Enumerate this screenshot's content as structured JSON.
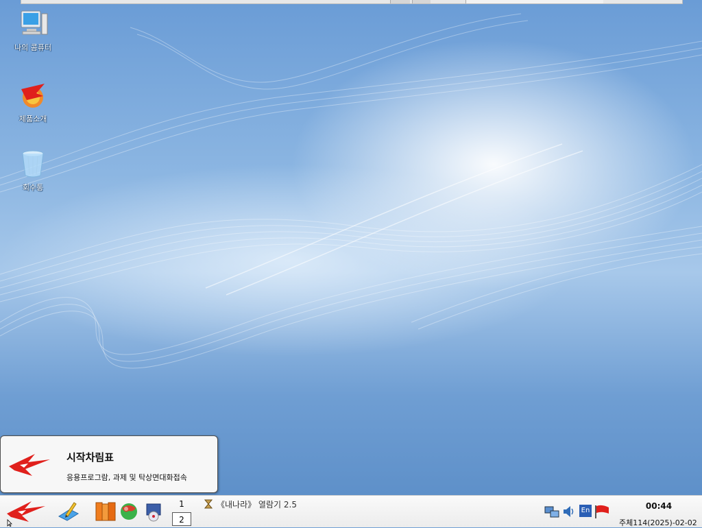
{
  "desktop": {
    "icons": [
      {
        "label": "나의 콤퓨터",
        "icon": "computer-icon"
      },
      {
        "label": "제품소개",
        "icon": "product-intro-icon"
      },
      {
        "label": "회수통",
        "icon": "recycle-bin-icon"
      }
    ]
  },
  "start_popup": {
    "title": "시작차림표",
    "description": "응용프로그람, 과제 및 탁상면대화접속"
  },
  "taskbar": {
    "start_icon": "red-star-start-icon",
    "launchers": [
      {
        "icon": "edit-tool-icon"
      },
      {
        "icon": "books-icon"
      },
      {
        "icon": "globe-browser-icon"
      },
      {
        "icon": "media-player-icon"
      }
    ],
    "workspaces": [
      "1",
      "2"
    ],
    "active_workspace": "2",
    "task_label": "《내나라》 열람기 2.5",
    "tray": [
      {
        "icon": "network-icon"
      },
      {
        "icon": "volume-icon"
      },
      {
        "icon": "input-method-en-icon",
        "text": "En"
      },
      {
        "icon": "flag-icon"
      }
    ],
    "clock": "00:44",
    "date": "주체114(2025)-02-02"
  },
  "colors": {
    "desktop_blue": "#6f9fd4",
    "accent_red": "#e0201c"
  }
}
